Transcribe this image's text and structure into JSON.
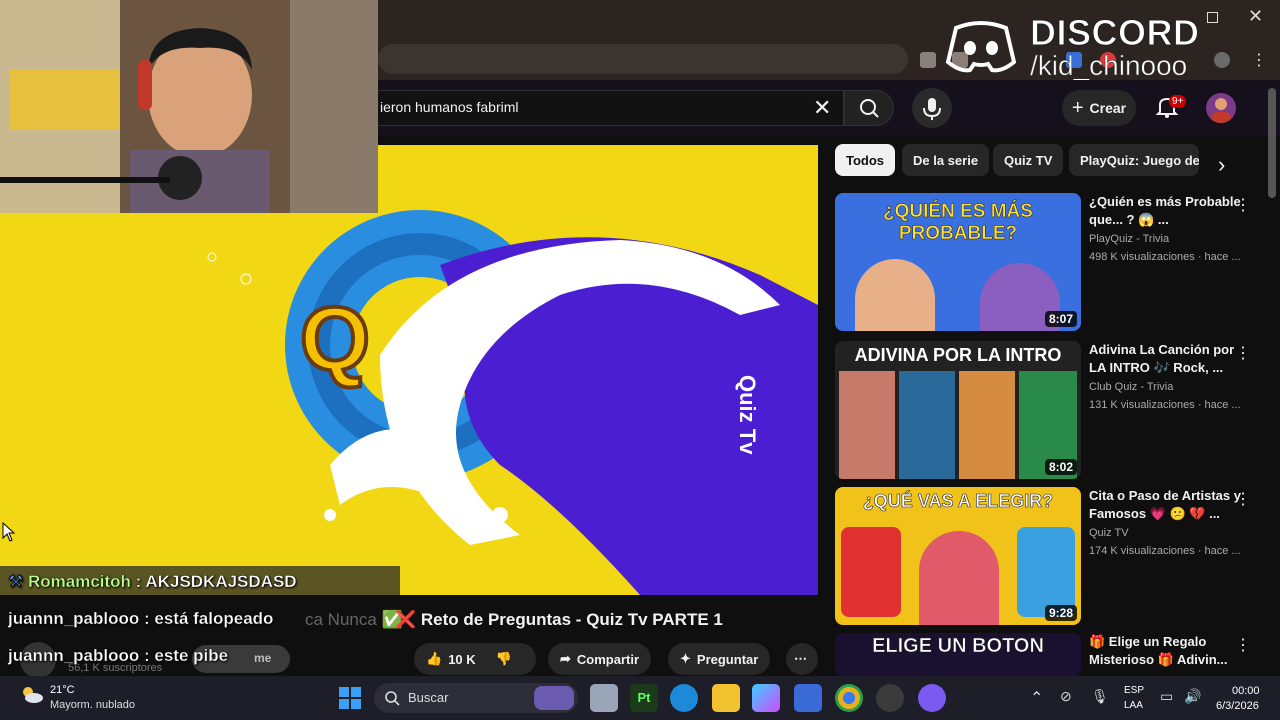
{
  "overlay": {
    "discord_title": "DISCORD",
    "discord_user": "/kid_chinooo"
  },
  "search": {
    "query": "ieron humanos fabriml"
  },
  "header": {
    "create_label": "Crear",
    "notif_badge": "9+"
  },
  "chips": [
    "Todos",
    "De la serie",
    "Quiz TV",
    "PlayQuiz: Juego de P"
  ],
  "chat": [
    {
      "user": "Romamcitoh",
      "message": " : AKJSDKAJSDASD"
    },
    {
      "user": "juannn_pablooo",
      "message": " : está falopeado"
    },
    {
      "user": "juannn_pablooo",
      "message": " : este pibe"
    }
  ],
  "video": {
    "title": "❌ Reto de Preguntas - Quiz Tv PARTE 1",
    "title_ghost": "ca Nunca ✅",
    "subs": "56,1 K suscriptores",
    "subscribe_ghost": "me",
    "likes": "10 K",
    "share_label": "Compartir",
    "ask_label": "Preguntar",
    "watermark": "Quiz Tv"
  },
  "sidebar": [
    {
      "title": "¿Quién es más Probable que... ? 😱 ...",
      "channel": "PlayQuiz - Trivia",
      "meta": "498 K visualizaciones · hace ...",
      "duration": "8:07",
      "thumb_text": "¿QUIÉN ES MÁS PROBABLE?",
      "thumb_color": "#3a6fe0"
    },
    {
      "title": "Adivina La Canción por LA INTRO 🎶 Rock, ...",
      "channel": "Club Quiz - Trivia",
      "meta": "131 K visualizaciones · hace ...",
      "duration": "8:02",
      "thumb_text": "ADIVINA POR LA INTRO",
      "thumb_color": "#222222"
    },
    {
      "title": "Cita o Paso de Artistas y Famosos 💗 😕 💔 ...",
      "channel": "Quiz TV",
      "meta": "174 K visualizaciones · hace ...",
      "duration": "9:28",
      "thumb_text": "¿QUÉ VAS A ELEGIR?",
      "thumb_color": "#f0c21a"
    },
    {
      "title": "🎁 Elige un Regalo Misterioso 🎁 Adivin...",
      "channel": "",
      "meta": "",
      "duration": "",
      "thumb_text": "ELIGE UN BOTON",
      "thumb_color": "#e03030"
    }
  ],
  "taskbar": {
    "temp": "21°C",
    "weather": "Mayorm. nublado",
    "search_label": "Buscar",
    "lang1": "ESP",
    "lang2": "LAA",
    "time": "00:00",
    "date": "6/3/2026"
  },
  "colors": {
    "video_bg": "#f2d714",
    "wave": "#4b1fd1",
    "chat_user": "#b8ff8a"
  }
}
